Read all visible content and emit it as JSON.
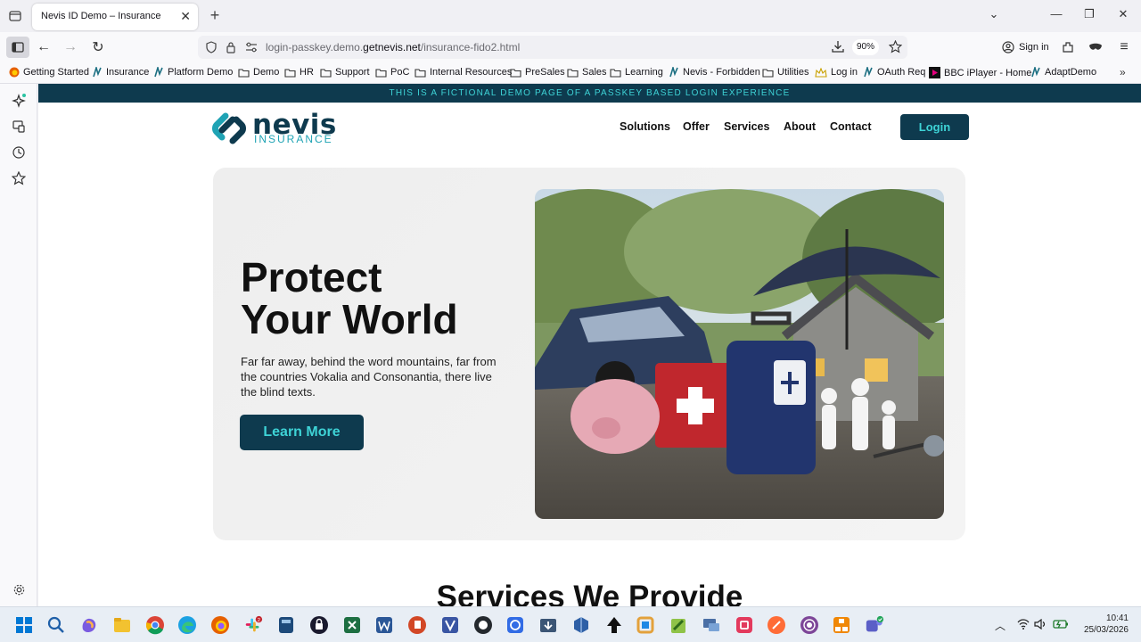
{
  "browser": {
    "tab_title": "Nevis ID Demo – Insurance",
    "url_prefix": "login-passkey.demo.",
    "url_domain": "getnevis.net",
    "url_path": "/insurance-fido2.html",
    "zoom": "90%",
    "signin_label": "Sign in"
  },
  "bookmarks": [
    {
      "label": "Getting Started",
      "icon": "firefox-icon"
    },
    {
      "label": "Insurance",
      "icon": "nevis-icon"
    },
    {
      "label": "Platform Demo",
      "icon": "nevis-icon"
    },
    {
      "label": "Demo",
      "icon": "folder-icon"
    },
    {
      "label": "HR",
      "icon": "folder-icon"
    },
    {
      "label": "Support",
      "icon": "folder-icon"
    },
    {
      "label": "PoC",
      "icon": "folder-icon"
    },
    {
      "label": "Internal Resources",
      "icon": "folder-icon"
    },
    {
      "label": "PreSales",
      "icon": "folder-icon"
    },
    {
      "label": "Sales",
      "icon": "folder-icon"
    },
    {
      "label": "Learning",
      "icon": "folder-icon"
    },
    {
      "label": "Nevis - Forbidden",
      "icon": "nevis-icon"
    },
    {
      "label": "Utilities",
      "icon": "folder-icon"
    },
    {
      "label": "Log in",
      "icon": "crown-icon"
    },
    {
      "label": "OAuth Req",
      "icon": "nevis-icon"
    },
    {
      "label": "BBC iPlayer - Home",
      "icon": "bbc-icon"
    },
    {
      "label": "AdaptDemo",
      "icon": "nevis-icon"
    }
  ],
  "page": {
    "banner": "THIS IS A FICTIONAL DEMO PAGE OF A PASSKEY BASED LOGIN EXPERIENCE",
    "logo_word": "nevis",
    "logo_sub": "INSURANCE",
    "menu": [
      "Solutions",
      "Offer",
      "Services",
      "About",
      "Contact"
    ],
    "login_label": "Login",
    "hero": {
      "title_line1": "Protect",
      "title_line2": "Your World",
      "text": "Far far away, behind the word mountains, far from the countries Vokalia and Consonantia, there live the blind texts.",
      "cta": "Learn More"
    },
    "services_heading": "Services We Provide"
  },
  "taskbar": {
    "time": "10:41",
    "date": "25/03/2026",
    "notification_badge": "2"
  },
  "colors": {
    "brand_dark": "#0e3a4e",
    "brand_accent": "#3ed3d6"
  }
}
